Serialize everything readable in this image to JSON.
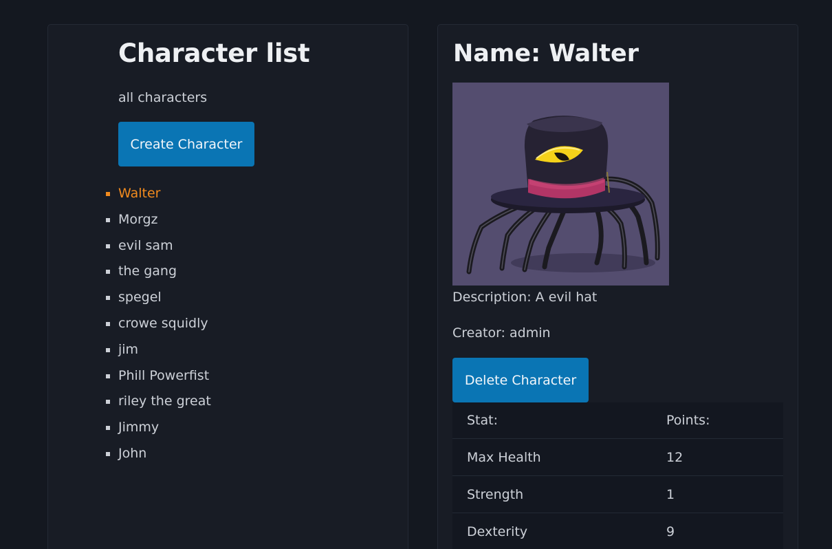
{
  "list_panel": {
    "title": "Character list",
    "subtitle": "all characters",
    "create_label": "Create Character",
    "characters": [
      "Walter",
      "Morgz",
      "evil sam",
      "the gang",
      "spegel",
      "crowe squidly",
      "jim",
      "Phill Powerfist",
      "riley the great",
      "Jimmy",
      "John"
    ],
    "active_index": 0
  },
  "detail_panel": {
    "title": "Name: Walter",
    "portrait_subject": "spider-hat-creature",
    "description": "Description: A evil hat",
    "creator": "Creator: admin",
    "delete_label": "Delete Character",
    "stats_table": {
      "headers": [
        "Stat:",
        "Points:"
      ],
      "rows": [
        [
          "Max Health",
          "12"
        ],
        [
          "Strength",
          "1"
        ],
        [
          "Dexterity",
          "9"
        ]
      ]
    }
  },
  "colors": {
    "background": "#141820",
    "panel": "#181c25",
    "accent_button": "#0a75b4",
    "active_item": "#f28b1e"
  }
}
